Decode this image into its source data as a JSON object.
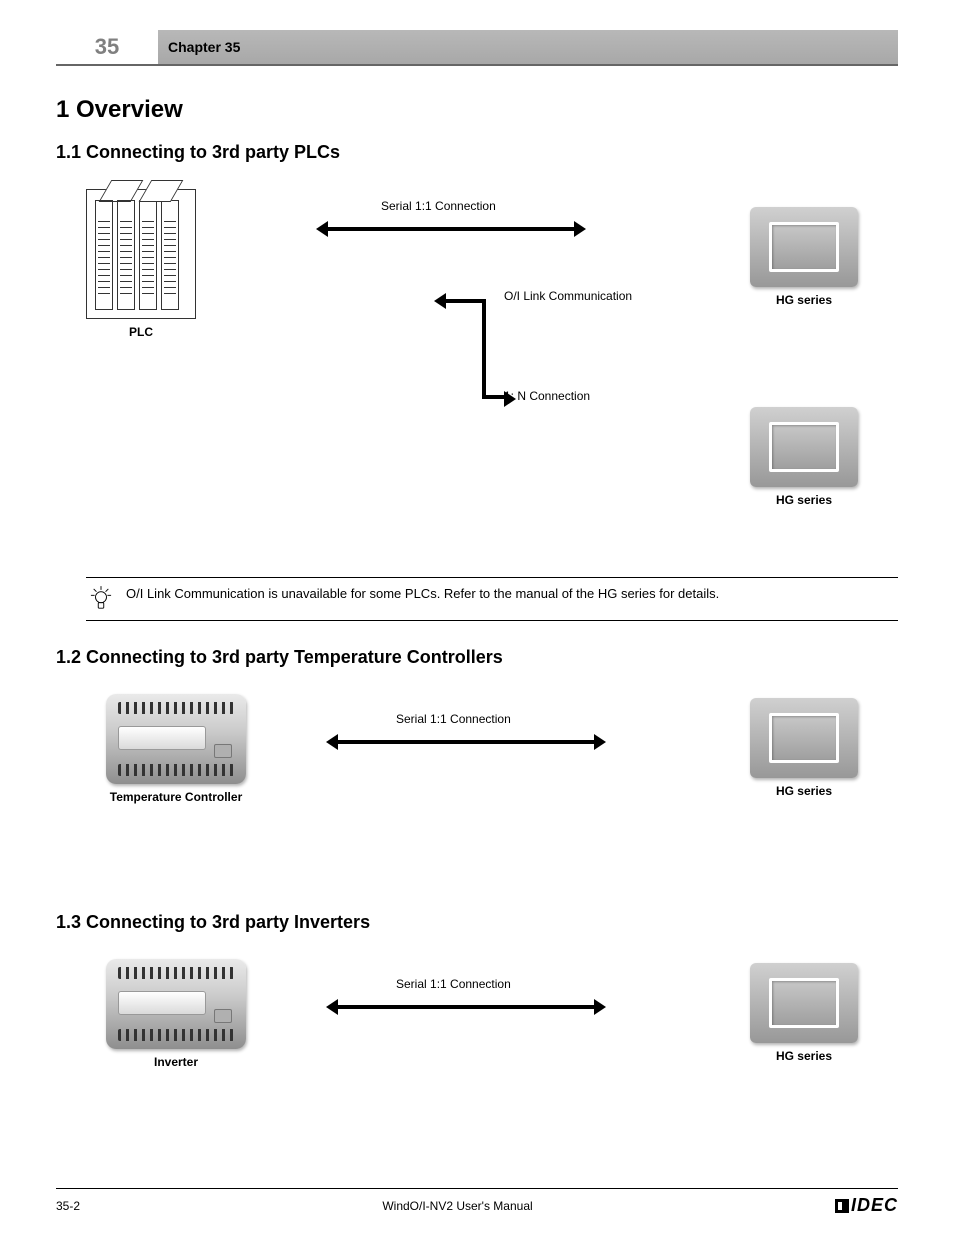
{
  "header": {
    "chapter_no": "35",
    "chapter_title": "Chapter 35"
  },
  "section1": {
    "title": "1  Overview",
    "subtitle": "1.1  Connecting to 3rd party PLCs",
    "label_plc": "PLC",
    "label_hg1": "HG series",
    "label_connection": "Serial 1:1 Connection",
    "label_branch1": "O/I Link Communication",
    "label_branch2": "1: N Connection",
    "label_hg2": "HG series",
    "note": "O/I Link Communication is unavailable for some PLCs. Refer to the manual of the HG series for details."
  },
  "section2": {
    "subtitle": "1.2  Connecting to 3rd party Temperature Controllers",
    "label_ctrl": "Temperature Controller",
    "label_conn": "Serial 1:1 Connection",
    "label_hg": "HG series"
  },
  "section3": {
    "subtitle": "1.3  Connecting to 3rd party Inverters",
    "label_ctrl": "Inverter",
    "label_conn": "Serial 1:1 Connection",
    "label_hg": "HG series"
  },
  "footer": {
    "page": "35-2",
    "manual": "WindO/I-NV2 User's Manual"
  }
}
